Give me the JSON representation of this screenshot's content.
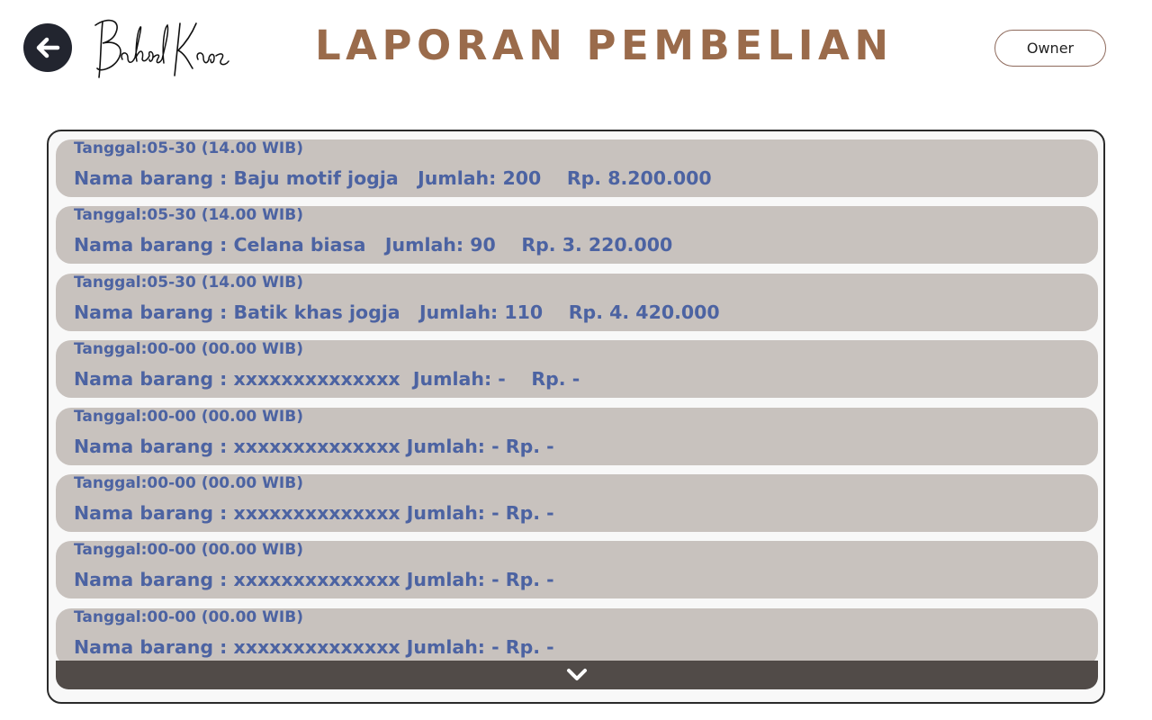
{
  "header": {
    "title": "LAPORAN PEMBELIAN",
    "logo_text": "BakoelKaos",
    "owner_label": "Owner",
    "back_icon": "arrow-left-icon"
  },
  "purchases": [
    {
      "date": "Tanggal:05-30 (14.00 WIB)",
      "line": "Nama barang : Baju motif jogja   Jumlah: 200    Rp. 8.200.000"
    },
    {
      "date": "Tanggal:05-30 (14.00 WIB)",
      "line": "Nama barang : Celana biasa   Jumlah: 90    Rp. 3. 220.000"
    },
    {
      "date": "Tanggal:05-30 (14.00 WIB)",
      "line": "Nama barang : Batik khas jogja   Jumlah: 110    Rp. 4. 420.000"
    },
    {
      "date": "Tanggal:00-00 (00.00 WIB)",
      "line": "Nama barang : xxxxxxxxxxxxxx  Jumlah: -    Rp. -"
    },
    {
      "date": "Tanggal:00-00 (00.00 WIB)",
      "line": "Nama barang : xxxxxxxxxxxxxx Jumlah: - Rp. -"
    },
    {
      "date": "Tanggal:00-00 (00.00 WIB)",
      "line": "Nama barang : xxxxxxxxxxxxxx Jumlah: - Rp. -"
    },
    {
      "date": "Tanggal:00-00 (00.00 WIB)",
      "line": "Nama barang : xxxxxxxxxxxxxx Jumlah: - Rp. -"
    },
    {
      "date": "Tanggal:00-00 (00.00 WIB)",
      "line": "Nama barang : xxxxxxxxxxxxxx Jumlah: - Rp. -"
    }
  ],
  "footer": {
    "scroll_icon": "chevron-down-icon"
  },
  "colors": {
    "title": "#9a6b4b",
    "item_bg": "#c8c2be",
    "item_text": "#4c63a2",
    "back_btn": "#22252f",
    "footer_bar": "#514b48"
  }
}
